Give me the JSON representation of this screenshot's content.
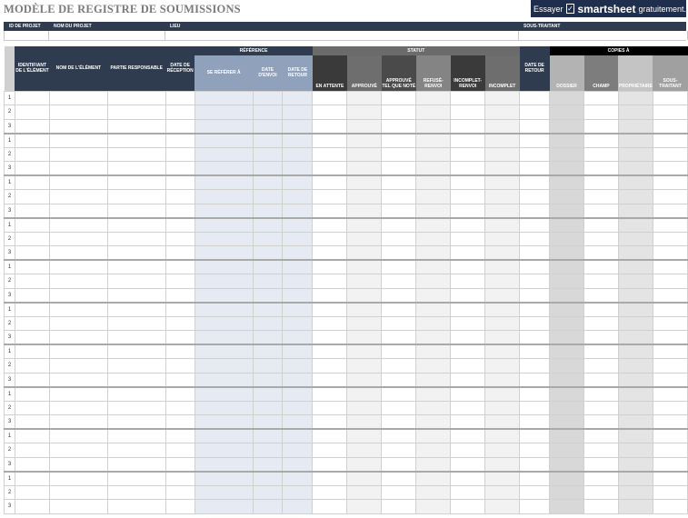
{
  "title": "MODÈLE DE REGISTRE DE SOUMISSIONS",
  "promo": {
    "prefix": "Essayer",
    "brand": "smartsheet",
    "suffix": "gratuitement.",
    "check_icon": "check-icon"
  },
  "project": {
    "headers": [
      "ID DE PROJET",
      "NOM DU PROJET",
      "LIEU",
      "SOUS-TRAITANT"
    ],
    "values": [
      "",
      "",
      "",
      ""
    ]
  },
  "groups": {
    "reference": "RÉFÉRENCE",
    "statut": "STATUT",
    "copies": "COPIES À"
  },
  "columns": {
    "identifiant": "IDENTIFIANT DE L'ÉLÉMENT",
    "nom": "NOM DE L'ÉLÉMENT",
    "partie": "PARTIE RESPONSABLE",
    "date_reception": "DATE DE RÉCEPTION",
    "se_referer": "SE RÉFÉRER À",
    "date_envoi": "DATE D'ENVOI",
    "date_retour": "DATE DE RETOUR",
    "en_attente": "EN ATTENTE",
    "approuve": "APPROUVÉ",
    "approuve_note": "APPROUVÉ TEL QUE NOTÉ",
    "refuse": "REFUSÉ-RENVOI",
    "incomplet_renvoi": "INCOMPLET-RENVOI",
    "incomplet": "INCOMPLET",
    "date_retour2": "DATE DE RETOUR",
    "dossier": "DOSSIER",
    "champ": "CHAMP",
    "proprietaire": "PROPRIÉTAIRE",
    "sous_traitant": "SOUS-TRAITANT"
  },
  "row_numbers": [
    "1",
    "2",
    "3",
    "1",
    "2",
    "3",
    "1",
    "2",
    "3",
    "1",
    "2",
    "3",
    "1",
    "2",
    "3",
    "1",
    "2",
    "3",
    "1",
    "2",
    "3",
    "1",
    "2",
    "3",
    "1",
    "2",
    "3",
    "1",
    "2",
    "3"
  ]
}
